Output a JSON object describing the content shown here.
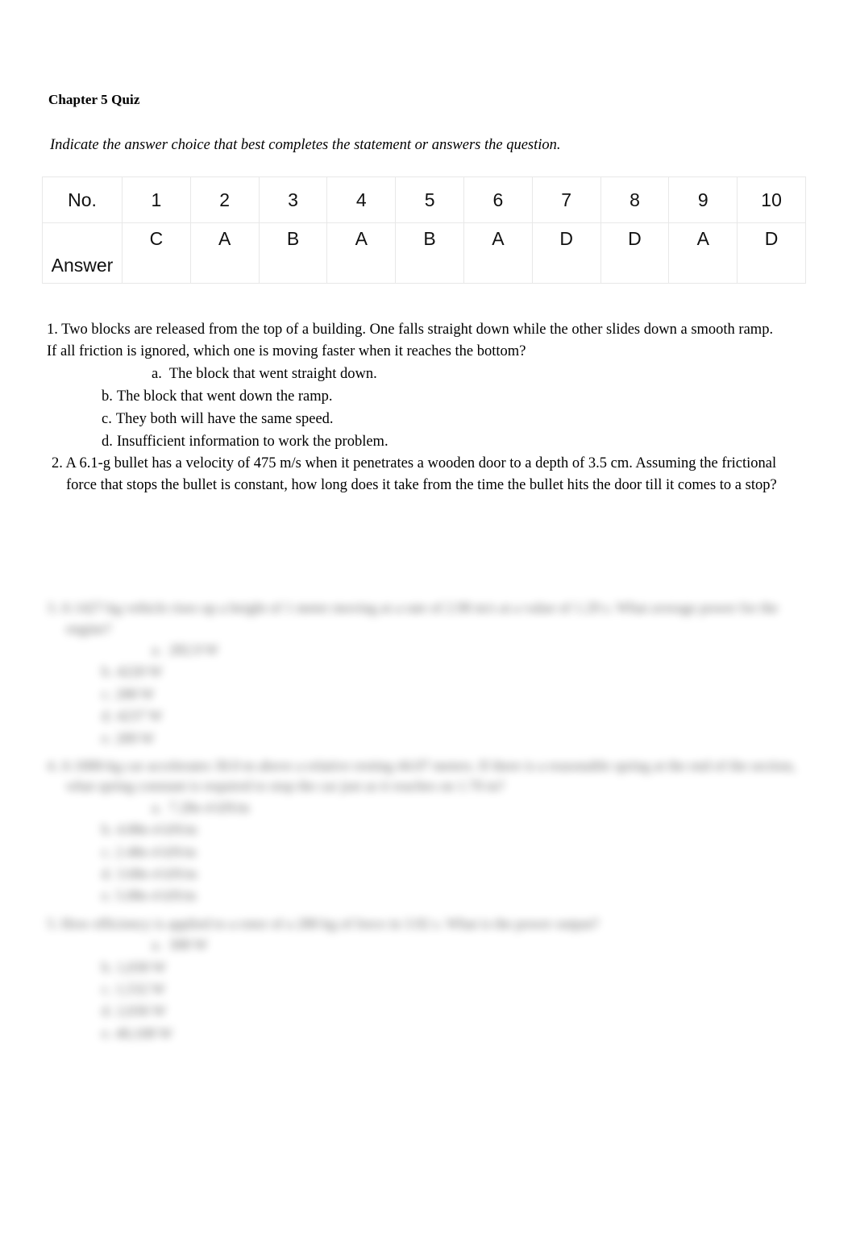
{
  "document": {
    "title": "Chapter 5 Quiz",
    "instruction": "Indicate the answer choice that best completes the statement or answers the question."
  },
  "answer_key": {
    "row_labels": {
      "number": "No.",
      "answer": "Answer"
    },
    "numbers": [
      "1",
      "2",
      "3",
      "4",
      "5",
      "6",
      "7",
      "8",
      "9",
      "10"
    ],
    "answers": [
      "C",
      "A",
      "B",
      "A",
      "B",
      "A",
      "D",
      "D",
      "A",
      "D"
    ]
  },
  "questions": [
    {
      "number": "1.",
      "line1": "1. Two blocks are released from the top of a building. One falls straight down while the other slides down a smooth ramp.",
      "line2": "If all friction is ignored, which one is moving faster when it reaches the bottom?",
      "choices": [
        {
          "letter": "a.",
          "text": "The block that went straight down."
        },
        {
          "letter": "b.",
          "text": "The block that went down the ramp."
        },
        {
          "letter": "c.",
          "text": "They both will have the same speed."
        },
        {
          "letter": "d.",
          "text": "Insufficient information to work the problem."
        }
      ]
    },
    {
      "number": "2.",
      "line1": "2. A 6.1-g bullet has a velocity of 475 m/s when it penetrates a wooden door to a depth of 3.5 cm. Assuming the frictional",
      "line2": "force that stops the bullet is constant, how long does it take from the time the bullet hits the door till it comes to a stop?",
      "choices": []
    }
  ],
  "obscured_questions": [
    {
      "line1": "3. A 1427-kg vehicle rises up a height of 1 meter moving at a rate of 2.90 m/s at a value of 1.29 s.  What average power for the",
      "line2": "engine?",
      "choices": [
        {
          "letter": "a.",
          "text": "282.9 W"
        },
        {
          "letter": "b.",
          "text": "4220 W"
        },
        {
          "letter": "c.",
          "text": "288 W"
        },
        {
          "letter": "d.",
          "text": "4237 W"
        },
        {
          "letter": "e.",
          "text": "289 W"
        }
      ]
    },
    {
      "line1": "4. A 1000-kg car accelerates 30.0 m above a relative resting 44.07 meters. If there is a reasonable spring at the end of the section,",
      "line2": "what spring constant is required to stop the car just as it reaches on 1.70 m?",
      "choices": [
        {
          "letter": "a.",
          "text": "7.28e-4 kN/m"
        },
        {
          "letter": "b.",
          "text": "4.88e-4 kN/m"
        },
        {
          "letter": "c.",
          "text": "2.48e-4 kN/m"
        },
        {
          "letter": "d.",
          "text": "3.68e-4 kN/m"
        },
        {
          "letter": "e.",
          "text": "5.08e-4 kN/m"
        }
      ]
    },
    {
      "line1": "5. How efficiency is applied to a rotor of a 280 kg of force in 3.92 s. What is the power output?",
      "choices": [
        {
          "letter": "a.",
          "text": "308 W"
        },
        {
          "letter": "b.",
          "text": "1,030 W"
        },
        {
          "letter": "c.",
          "text": "1,532 W"
        },
        {
          "letter": "d.",
          "text": "2,036 W"
        },
        {
          "letter": "e.",
          "text": "40,108 W"
        }
      ]
    }
  ]
}
